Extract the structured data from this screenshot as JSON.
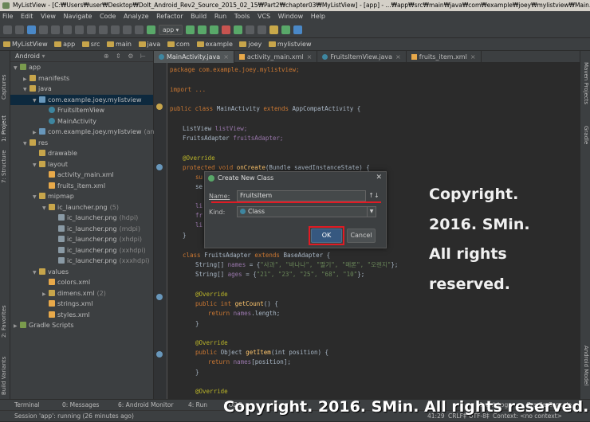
{
  "window": {
    "title": "MyListView - [C:₩Users₩user₩Desktop₩DoIt_Android_Rev2_Source_2015_02_15₩Part2₩chapter03₩MyListView] - [app] - ...₩app₩src₩main₩java₩com₩example₩joey₩mylistview₩Main..."
  },
  "menu": [
    "File",
    "Edit",
    "View",
    "Navigate",
    "Code",
    "Analyze",
    "Refactor",
    "Build",
    "Run",
    "Tools",
    "VCS",
    "Window",
    "Help"
  ],
  "toolbar": {
    "run_config": "app ▾"
  },
  "breadcrumb": [
    "MyListView",
    "app",
    "src",
    "main",
    "java",
    "com",
    "example",
    "joey",
    "mylistview"
  ],
  "left_tool_tabs": [
    "Captures",
    "1: Project",
    "7: Structure",
    "2: Favorites",
    "Build Variants"
  ],
  "right_tool_tabs": [
    "Maven Projects",
    "Gradle",
    "Android Model"
  ],
  "project": {
    "view": "Android",
    "tools": "⊕ ⇕ ⚙ ⊢",
    "tree": [
      {
        "label": "app",
        "depth": 0,
        "icon": "app",
        "open": true
      },
      {
        "label": "manifests",
        "depth": 1,
        "icon": "fold",
        "open": false
      },
      {
        "label": "java",
        "depth": 1,
        "icon": "fold",
        "open": true
      },
      {
        "label": "com.example.joey.mylistview",
        "depth": 2,
        "icon": "fold blue",
        "open": true,
        "selected": true
      },
      {
        "label": "FruitsItemView",
        "depth": 3,
        "icon": "cls"
      },
      {
        "label": "MainActivity",
        "depth": 3,
        "icon": "cls"
      },
      {
        "label": "com.example.joey.mylistview",
        "suffix": "(andro",
        "depth": 2,
        "icon": "fold blue",
        "open": false
      },
      {
        "label": "res",
        "depth": 1,
        "icon": "fold",
        "open": true
      },
      {
        "label": "drawable",
        "depth": 2,
        "icon": "fold"
      },
      {
        "label": "layout",
        "depth": 2,
        "icon": "fold",
        "open": true
      },
      {
        "label": "activity_main.xml",
        "depth": 3,
        "icon": "xml"
      },
      {
        "label": "fruits_item.xml",
        "depth": 3,
        "icon": "xml"
      },
      {
        "label": "mipmap",
        "depth": 2,
        "icon": "fold",
        "open": true
      },
      {
        "label": "ic_launcher.png",
        "suffix": "(5)",
        "depth": 3,
        "icon": "fold",
        "open": true
      },
      {
        "label": "ic_launcher.png",
        "suffix": "(hdpi)",
        "depth": 4,
        "icon": "png"
      },
      {
        "label": "ic_launcher.png",
        "suffix": "(mdpi)",
        "depth": 4,
        "icon": "png"
      },
      {
        "label": "ic_launcher.png",
        "suffix": "(xhdpi)",
        "depth": 4,
        "icon": "png"
      },
      {
        "label": "ic_launcher.png",
        "suffix": "(xxhdpi)",
        "depth": 4,
        "icon": "png"
      },
      {
        "label": "ic_launcher.png",
        "suffix": "(xxxhdpi)",
        "depth": 4,
        "icon": "png"
      },
      {
        "label": "values",
        "depth": 2,
        "icon": "fold",
        "open": true
      },
      {
        "label": "colors.xml",
        "depth": 3,
        "icon": "xml"
      },
      {
        "label": "dimens.xml",
        "suffix": "(2)",
        "depth": 3,
        "icon": "fold",
        "open": false
      },
      {
        "label": "strings.xml",
        "depth": 3,
        "icon": "xml"
      },
      {
        "label": "styles.xml",
        "depth": 3,
        "icon": "xml"
      },
      {
        "label": "Gradle Scripts",
        "depth": 0,
        "icon": "app",
        "open": false
      }
    ]
  },
  "editor_tabs": [
    {
      "label": "MainActivity.java",
      "kind": "class",
      "active": true
    },
    {
      "label": "activity_main.xml",
      "kind": "xml"
    },
    {
      "label": "FruitsItemView.java",
      "kind": "class"
    },
    {
      "label": "fruits_item.xml",
      "kind": "xml"
    }
  ],
  "code": {
    "l1": "package com.example.joey.mylistview;",
    "l2": "import ...",
    "l3a": "public class ",
    "l3b": "MainActivity ",
    "l3c": "extends ",
    "l3d": "AppCompatActivity {",
    "l4a": "ListView ",
    "l4b": "listView;",
    "l5a": "FruitsAdapter ",
    "l5b": "fruitsAdapter;",
    "l6": "@Override",
    "l7a": "protected void ",
    "l7b": "onCreate",
    "l7c": "(Bundle savedInstanceState) {",
    "l8": "su",
    "l9": "se",
    "l10": "li",
    "l11": "fr",
    "l12": "li",
    "l13": "}",
    "l14a": "class ",
    "l14b": "FruitsAdapter ",
    "l14c": "extends ",
    "l14d": "BaseAdapter {",
    "l15a": "String[] ",
    "l15b": "names ",
    "l15c": "= {",
    "l15d": "\"사과\", \"바나나\", \"딸기\", \"메론\", \"오렌지\"",
    "l15e": "};",
    "l16a": "String[] ",
    "l16b": "ages ",
    "l16c": "= {",
    "l16d": "\"21\", \"23\", \"25\", \"68\", \"10\"",
    "l16e": "};",
    "l17": "@Override",
    "l18a": "public int ",
    "l18b": "getCount",
    "l18c": "() {",
    "l19a": "return ",
    "l19b": "names",
    "l19c": ".length;",
    "l20": "}",
    "l21": "@Override",
    "l22a": "public ",
    "l22b": "Object ",
    "l22c": "getItem",
    "l22d": "(int position) {",
    "l23a": "return ",
    "l23b": "names",
    "l23c": "[position];",
    "l24": "}",
    "l25": "@Override"
  },
  "dialog": {
    "title": "Create New Class",
    "name_label": "Name:",
    "name_value": "FruitsItem",
    "updown": "↑↓",
    "kind_label": "Kind:",
    "kind_value": "Class",
    "ok_label": "OK",
    "cancel_label": "Cancel",
    "close": "✕"
  },
  "watermark": {
    "side_lines": [
      "Copyright.",
      "2016. SMin.",
      "All rights",
      "reserved."
    ],
    "bottom": "Copyright. 2016. SMin. All rights reserved."
  },
  "bottom_tools": [
    "Terminal",
    "0: Messages",
    "6: Android Monitor",
    "4: Run",
    "TODO",
    "Event Log",
    "Gradle Console"
  ],
  "status": {
    "message": "Session 'app': running (26 minutes ago)",
    "position": "41:29",
    "line_sep": "CRLF‡",
    "encoding": "UTF-8‡",
    "context": "Context: <no context>"
  }
}
